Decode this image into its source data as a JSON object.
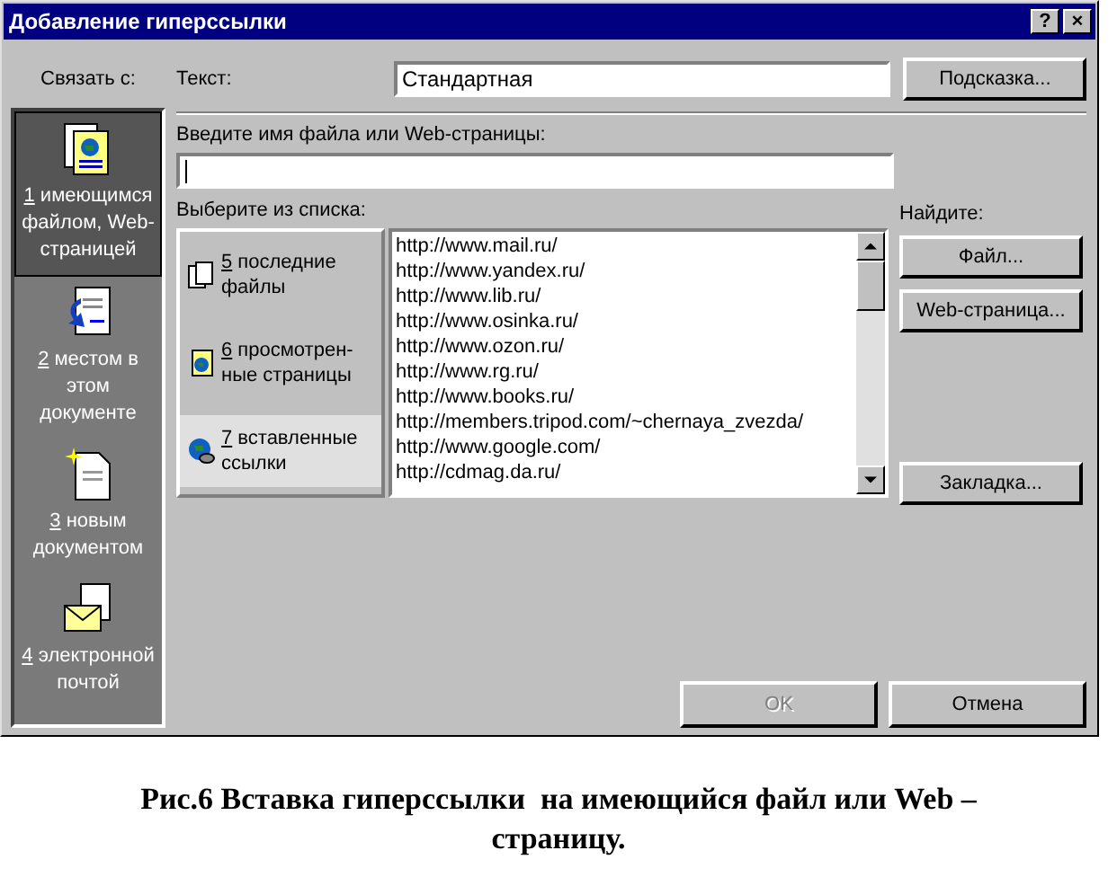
{
  "window": {
    "title": "Добавление гиперссылки",
    "title_buttons": [
      "?",
      "×"
    ]
  },
  "link_to": {
    "label": "Связать с:",
    "items": [
      {
        "number": "1",
        "label": "имеющимся файлом, Web-страницей",
        "kind": "file",
        "selected": true
      },
      {
        "number": "2",
        "label": "местом в этом документе",
        "kind": "place",
        "selected": false
      },
      {
        "number": "3",
        "label": "новым документом",
        "kind": "new",
        "selected": false
      },
      {
        "number": "4",
        "label": "электронной почтой",
        "kind": "mail",
        "selected": false
      }
    ]
  },
  "text_field": {
    "label": "Текст:",
    "value": "Стандартная"
  },
  "hint_button": "Подсказка...",
  "address_field": {
    "label": "Введите имя файла или Web-страницы:"
  },
  "choose": {
    "label": "Выберите из списка:",
    "categories": [
      {
        "number": "5",
        "label": "последние файлы",
        "kind": "recent",
        "selected": false
      },
      {
        "number": "6",
        "label": "просмотрен-ные страницы",
        "kind": "browsed",
        "selected": false
      },
      {
        "number": "7",
        "label": "вставленные ссылки",
        "kind": "links",
        "selected": true
      }
    ],
    "urls": [
      "http://www.mail.ru/",
      "http://www.yandex.ru/",
      "http://www.lib.ru/",
      "http://www.osinka.ru/",
      "http://www.ozon.ru/",
      "http://www.rg.ru/",
      "http://www.books.ru/",
      "http://members.tripod.com/~chernaya_zvezda/",
      "http://www.google.com/",
      "http://cdmag.da.ru/"
    ]
  },
  "find": {
    "label": "Найдите:",
    "buttons": [
      "Файл...",
      "Web-страница..."
    ]
  },
  "bookmark_button": "Закладка...",
  "footer_buttons": [
    {
      "label": "OK",
      "disabled": true
    },
    {
      "label": "Отмена",
      "disabled": false
    }
  ],
  "caption": "Рис.6 Вставка гиперссылки  на имеющийся файл или Web – страницу."
}
